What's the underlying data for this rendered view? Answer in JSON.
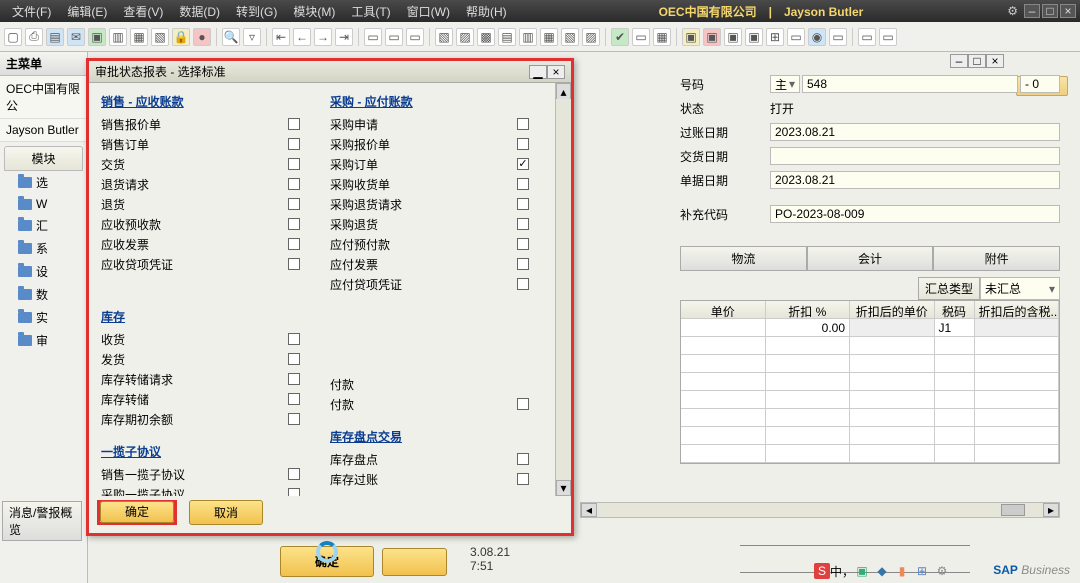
{
  "menubar": {
    "items": [
      "文件(F)",
      "编辑(E)",
      "查看(V)",
      "数据(D)",
      "转到(G)",
      "模块(M)",
      "工具(T)",
      "窗口(W)",
      "帮助(H)"
    ],
    "title": "OEC中国有限公司　|　Jayson Butler"
  },
  "sidebar": {
    "header": "主菜单",
    "company": "OEC中国有限公",
    "user": "Jayson Butler",
    "tab": "模块",
    "items": [
      "选",
      "W",
      "汇",
      "系",
      "设",
      "数",
      "实",
      "审"
    ]
  },
  "doc": {
    "fields": {
      "code_label": "号码",
      "code_main": "主",
      "code_num": "548",
      "code_suffix": "- 0",
      "status_label": "状态",
      "status_val": "打开",
      "postdate_label": "过账日期",
      "postdate_val": "2023.08.21",
      "deliverdate_label": "交货日期",
      "deliverdate_val": "",
      "docdate_label": "单据日期",
      "docdate_val": "2023.08.21",
      "extra_label": "补充代码",
      "extra_val": "PO-2023-08-009"
    },
    "tabs": [
      "物流",
      "会计",
      "附件"
    ],
    "grid": {
      "summary_label": "汇总类型",
      "summary_val": "未汇总",
      "cols": [
        "单价",
        "折扣 %",
        "折扣后的单价",
        "税码",
        "折扣后的含税..."
      ],
      "row1": {
        "discount": "0.00",
        "tax": "J1"
      }
    },
    "small_line1": "3.08.21",
    "small_line2": "7:51",
    "confirm": "确定"
  },
  "dialog": {
    "title": "审批状态报表 - 选择标准",
    "col1_title": "销售 - 应收账款",
    "col1_items": [
      "销售报价单",
      "销售订单",
      "交货",
      "退货请求",
      "退货",
      "应收预收款",
      "应收发票",
      "应收贷项凭证"
    ],
    "col2_title": "采购 - 应付账款",
    "col2_items": [
      "采购申请",
      "采购报价单",
      "采购订单",
      "采购收货单",
      "采购退货请求",
      "采购退货",
      "应付预付款",
      "应付发票",
      "应付贷项凭证"
    ],
    "col2_checked_index": 2,
    "inv_title": "库存",
    "inv_items": [
      "收货",
      "发货",
      "库存转储请求",
      "库存转储",
      "库存期初余额"
    ],
    "pay_items": [
      "付款",
      "付款"
    ],
    "agree_title": "一揽子协议",
    "agree_items": [
      "销售一揽子协议",
      "采购一揽子协议"
    ],
    "stock_title": "库存盘点交易",
    "stock_items": [
      "库存盘点",
      "库存过账"
    ],
    "ok": "确定",
    "cancel": "取消"
  },
  "msgbar": "消息/警报概览",
  "search": "查找",
  "sap": {
    "brand": "SAP",
    "sub": "Business"
  },
  "tray_text": "中，"
}
